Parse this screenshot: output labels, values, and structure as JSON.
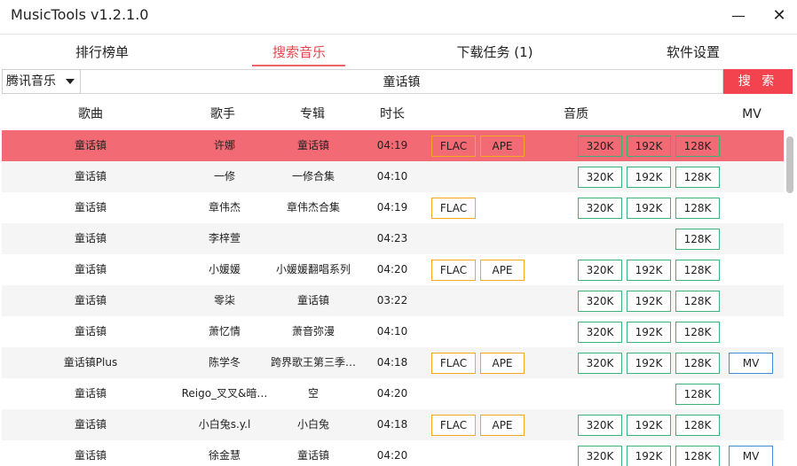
{
  "window": {
    "title": "MusicTools v1.2.1.0",
    "minimize_icon": "minus-icon",
    "close_icon": "close-icon"
  },
  "tabs": [
    {
      "label": "排行榜单",
      "active": false
    },
    {
      "label": "搜索音乐",
      "active": true
    },
    {
      "label": "下载任务 (1)",
      "active": false
    },
    {
      "label": "软件设置",
      "active": false
    }
  ],
  "search": {
    "source": "腾讯音乐",
    "query": "童话镇",
    "button_label": "搜 索"
  },
  "columns": {
    "song": "歌曲",
    "artist": "歌手",
    "album": "专辑",
    "duration": "时长",
    "quality": "音质",
    "mv": "MV"
  },
  "colors": {
    "accent": "#f2434e",
    "selected_row": "#f26a73",
    "lossless_border": "#f5a623",
    "bitrate_border": "#3db37a",
    "mv_border": "#3d8fd1"
  },
  "rows": [
    {
      "song": "童话镇",
      "artist": "许娜",
      "album": "童话镇",
      "duration": "04:19",
      "flac": "FLAC",
      "ape": "APE",
      "q320": "320K",
      "q192": "192K",
      "q128": "128K",
      "mv": ""
    },
    {
      "song": "童话镇",
      "artist": "一修",
      "album": "一修合集",
      "duration": "04:10",
      "flac": "",
      "ape": "",
      "q320": "320K",
      "q192": "192K",
      "q128": "128K",
      "mv": ""
    },
    {
      "song": "童话镇",
      "artist": "章伟杰",
      "album": "章伟杰合集",
      "duration": "04:19",
      "flac": "FLAC",
      "ape": "",
      "q320": "320K",
      "q192": "192K",
      "q128": "128K",
      "mv": ""
    },
    {
      "song": "童话镇",
      "artist": "李梓萱",
      "album": "",
      "duration": "04:23",
      "flac": "",
      "ape": "",
      "q320": "",
      "q192": "",
      "q128": "128K",
      "mv": ""
    },
    {
      "song": "童话镇",
      "artist": "小媛媛",
      "album": "小媛媛翻唱系列",
      "duration": "04:20",
      "flac": "FLAC",
      "ape": "APE",
      "q320": "320K",
      "q192": "192K",
      "q128": "128K",
      "mv": ""
    },
    {
      "song": "童话镇",
      "artist": "零柒",
      "album": "童话镇",
      "duration": "03:22",
      "flac": "",
      "ape": "",
      "q320": "320K",
      "q192": "192K",
      "q128": "128K",
      "mv": ""
    },
    {
      "song": "童话镇",
      "artist": "萧忆情",
      "album": "萧音弥漫",
      "duration": "04:10",
      "flac": "",
      "ape": "",
      "q320": "320K",
      "q192": "192K",
      "q128": "128K",
      "mv": ""
    },
    {
      "song": "童话镇Plus",
      "artist": "陈学冬",
      "album": "跨界歌王第三季…",
      "duration": "04:18",
      "flac": "FLAC",
      "ape": "APE",
      "q320": "320K",
      "q192": "192K",
      "q128": "128K",
      "mv": "MV"
    },
    {
      "song": "童话镇",
      "artist": "Reigo_叉叉&暗…",
      "album": "空",
      "duration": "04:20",
      "flac": "",
      "ape": "",
      "q320": "",
      "q192": "",
      "q128": "128K",
      "mv": ""
    },
    {
      "song": "童话镇",
      "artist": "小白兔s.y.l",
      "album": "小白兔",
      "duration": "04:18",
      "flac": "FLAC",
      "ape": "APE",
      "q320": "320K",
      "q192": "192K",
      "q128": "128K",
      "mv": ""
    },
    {
      "song": "童话镇",
      "artist": "徐金慧",
      "album": "童话镇",
      "duration": "04:20",
      "flac": "",
      "ape": "",
      "q320": "320K",
      "q192": "192K",
      "q128": "128K",
      "mv": "MV"
    }
  ]
}
